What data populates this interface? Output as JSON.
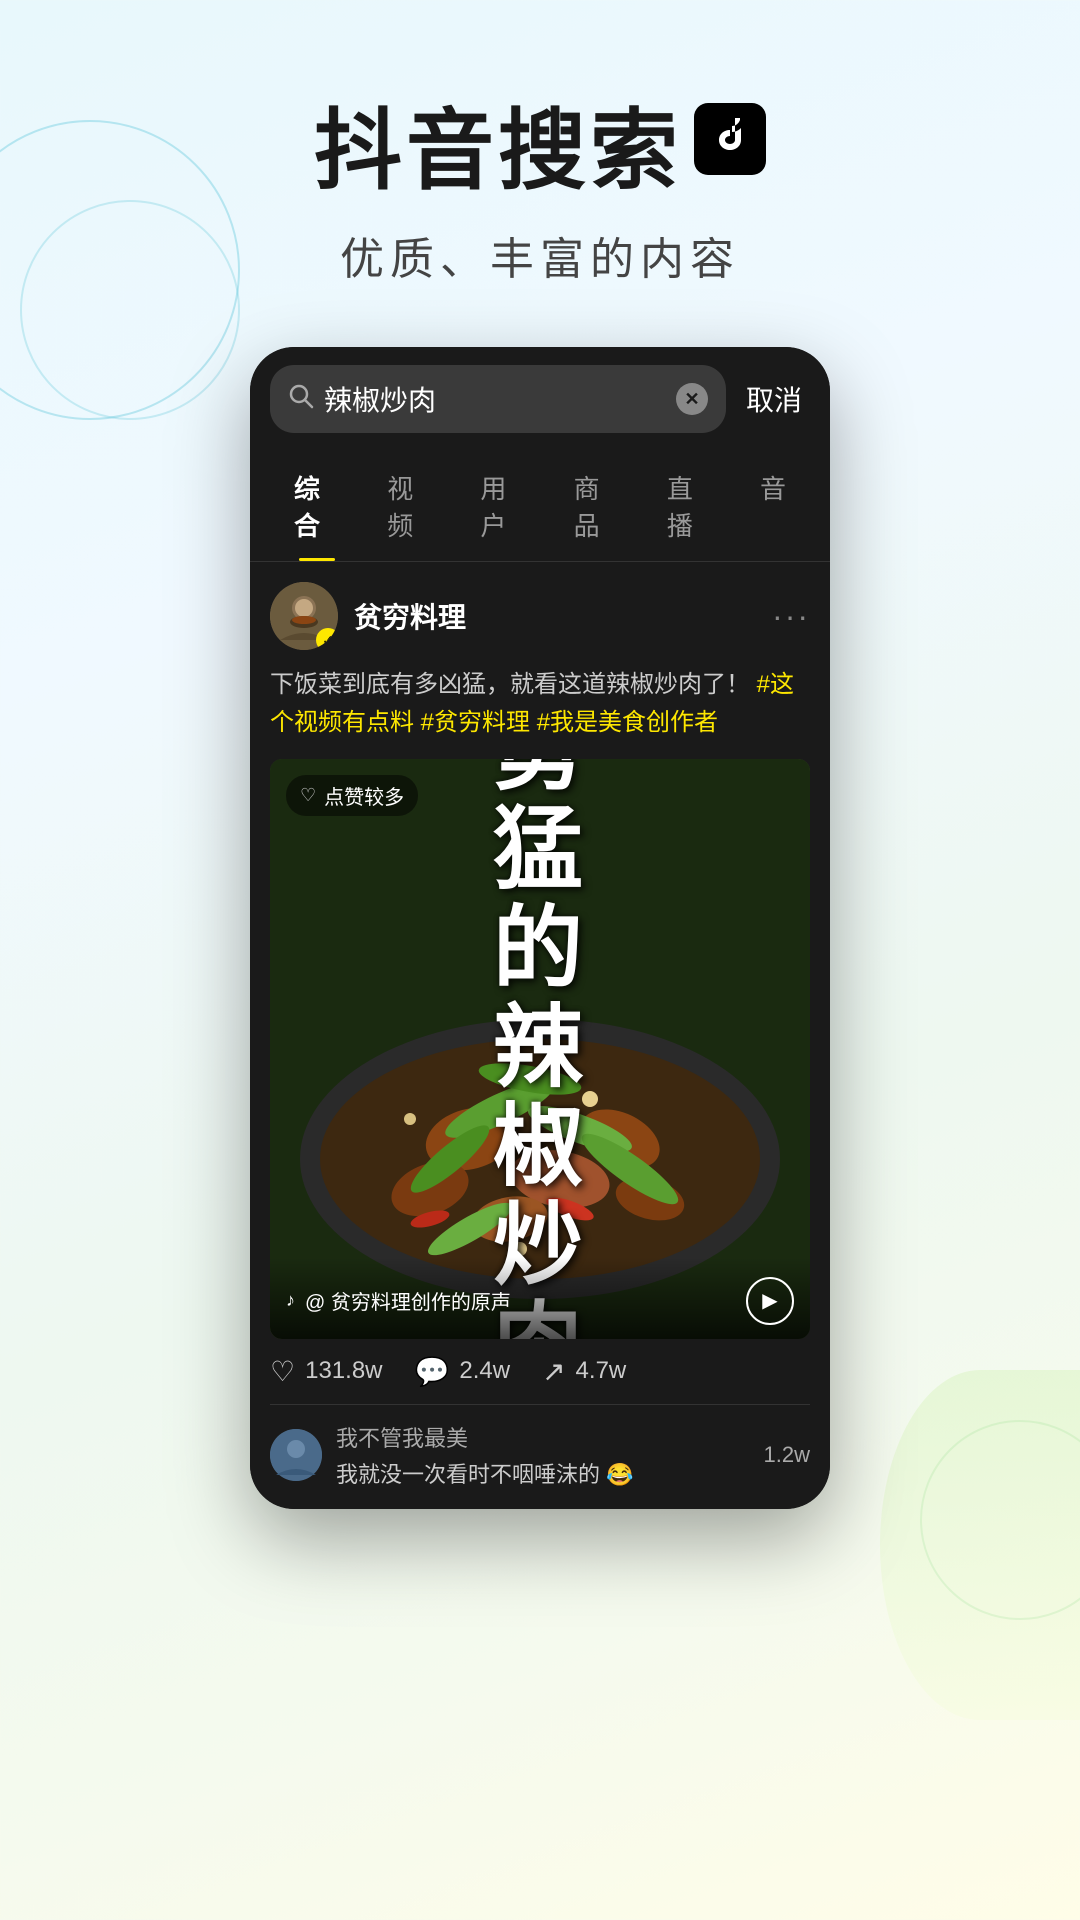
{
  "page": {
    "bg_title": "抖音搜索",
    "tiktok_logo_symbol": "♪",
    "subtitle": "优质、丰富的内容"
  },
  "search": {
    "query": "辣椒炒肉",
    "placeholder": "辣椒炒肉",
    "cancel_label": "取消"
  },
  "tabs": [
    {
      "label": "综合",
      "active": true
    },
    {
      "label": "视频",
      "active": false
    },
    {
      "label": "用户",
      "active": false
    },
    {
      "label": "商品",
      "active": false
    },
    {
      "label": "直播",
      "active": false
    },
    {
      "label": "音",
      "active": false
    }
  ],
  "post": {
    "username": "贫穷料理",
    "verified": true,
    "description": "下饭菜到底有多凶猛，就看这道辣椒炒肉了！",
    "hashtags": [
      "#这个视频有点料",
      "#贫穷料理",
      "#我是美食创作者"
    ],
    "like_badge": "点赞较多",
    "video_title": "勇猛的辣椒炒肉",
    "sound_info": "@ 贫穷料理创作的原声",
    "likes": "131.8w",
    "comments": "2.4w",
    "shares": "4.7w",
    "comment_user": "我不管我最美",
    "comment_text": "我就没一次看时不咽唾沫的 😂",
    "comment_count": "1.2w"
  },
  "colors": {
    "accent_yellow": "#FEE700",
    "bg_dark": "#1a1a1a",
    "text_primary": "#ffffff",
    "text_secondary": "#cccccc",
    "hashtag_color": "#FEE700"
  }
}
